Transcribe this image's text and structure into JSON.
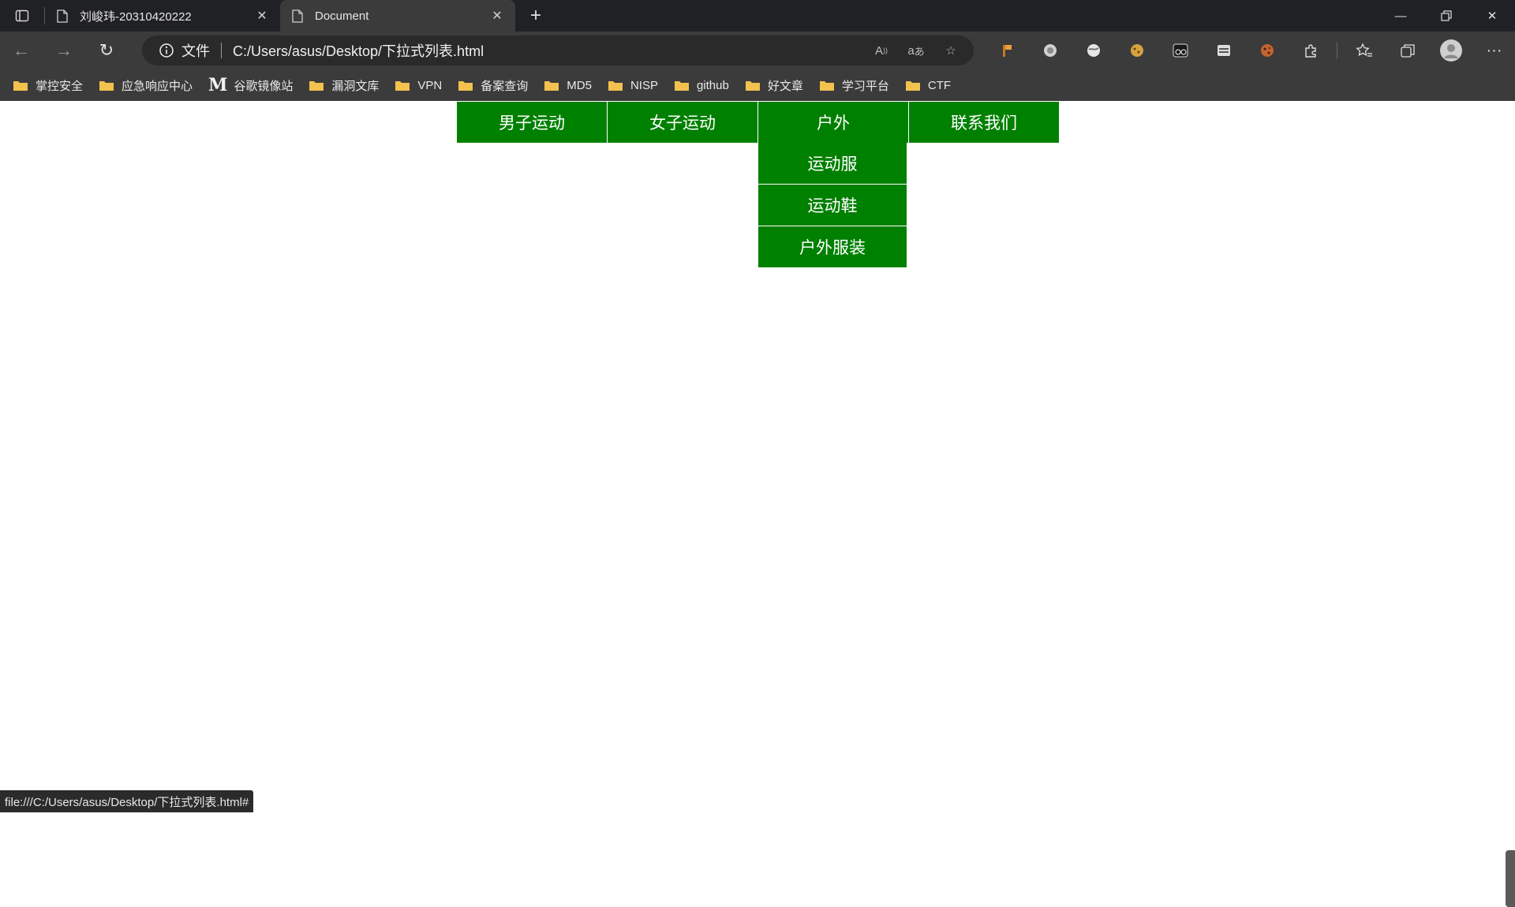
{
  "browser": {
    "tabs": [
      {
        "title": "刘峻玮-20310420222",
        "active": false
      },
      {
        "title": "Document",
        "active": true
      }
    ],
    "omnibox": {
      "scheme_label": "文件",
      "url": "C:/Users/asus/Desktop/下拉式列表.html"
    },
    "favorites": [
      {
        "label": "掌控安全",
        "type": "folder"
      },
      {
        "label": "应急响应中心",
        "type": "folder"
      },
      {
        "label": "谷歌镜像站",
        "type": "site",
        "logo": "M"
      },
      {
        "label": "漏洞文库",
        "type": "folder"
      },
      {
        "label": "VPN",
        "type": "folder"
      },
      {
        "label": "备案查询",
        "type": "folder"
      },
      {
        "label": "MD5",
        "type": "folder"
      },
      {
        "label": "NISP",
        "type": "folder"
      },
      {
        "label": "github",
        "type": "folder"
      },
      {
        "label": "好文章",
        "type": "folder"
      },
      {
        "label": "学习平台",
        "type": "folder"
      },
      {
        "label": "CTF",
        "type": "folder"
      }
    ],
    "status_text": "file:///C:/Users/asus/Desktop/下拉式列表.html#"
  },
  "page": {
    "menu": [
      {
        "label": "男子运动"
      },
      {
        "label": "女子运动"
      },
      {
        "label": "户外"
      },
      {
        "label": "联系我们"
      }
    ],
    "submenu": [
      {
        "label": "运动服"
      },
      {
        "label": "运动鞋"
      },
      {
        "label": "户外服装"
      }
    ]
  },
  "colors": {
    "menu_bg": "#008000",
    "menu_text": "#ffffff",
    "chrome_dark": "#202124",
    "chrome_mid": "#3b3b3b"
  }
}
